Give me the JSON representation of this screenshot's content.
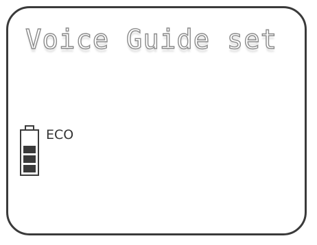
{
  "display": {
    "title": "Voice Guide set",
    "mode": "ECO",
    "battery_icon": "battery-icon",
    "battery_level_bars": 3
  },
  "colors": {
    "frame": "#3a3a3a",
    "lcd_text_outline": "#8a8a8a",
    "battery": "#3a3a3a"
  }
}
